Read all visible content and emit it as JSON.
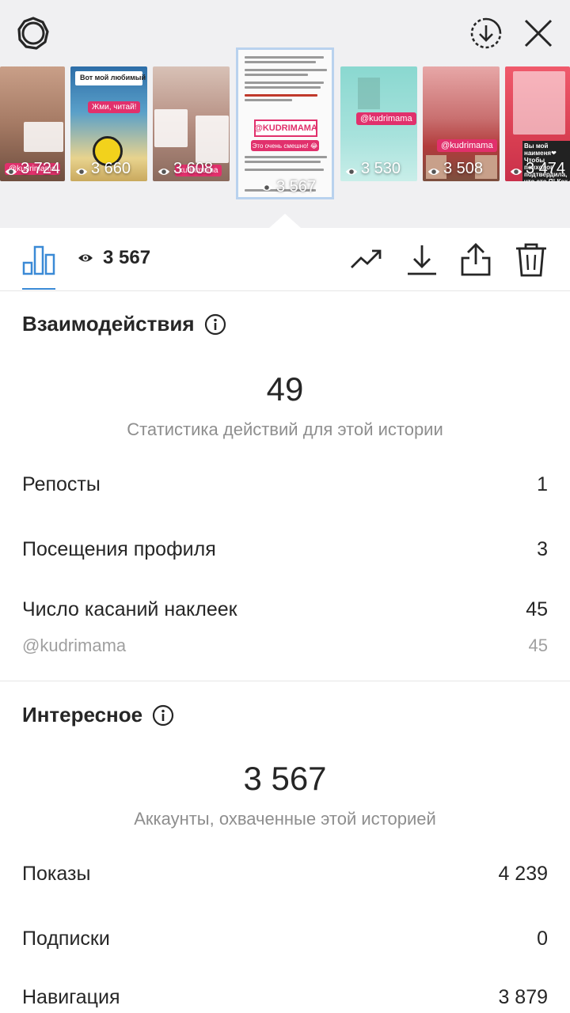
{
  "stories": [
    {
      "views": "3 724",
      "tag": "@kudrimama"
    },
    {
      "views": "3 660",
      "title": "Вот мой любимый 😅",
      "sticker": "Жми, читай!"
    },
    {
      "views": "3 608",
      "tag": "kudrimama"
    },
    {
      "views": "3 567",
      "current": true,
      "brand": "@KUDRIMAMA",
      "sticker": "Это очень смешно! 😂"
    },
    {
      "views": "3 530",
      "tag": "@kudrimama"
    },
    {
      "views": "3 508",
      "tag": "@kudrimama"
    },
    {
      "views": "3 474",
      "text": "Вы мой наименя❤ Чтобы психолог подтвердила, что это Я! Как за жизнь?"
    }
  ],
  "toolbar": {
    "view_count": "3 567"
  },
  "interactions": {
    "title": "Взаимодействия",
    "total": "49",
    "caption": "Статистика действий для этой истории",
    "rows": [
      {
        "label": "Репосты",
        "value": "1"
      },
      {
        "label": "Посещения профиля",
        "value": "3"
      },
      {
        "label": "Число касаний наклеек",
        "value": "45"
      }
    ],
    "sticker_row": {
      "label": "@kudrimama",
      "value": "45"
    }
  },
  "discovery": {
    "title": "Интересное",
    "total": "3 567",
    "caption": "Аккаунты, охваченные этой историей",
    "rows": [
      {
        "label": "Показы",
        "value": "4 239"
      },
      {
        "label": "Подписки",
        "value": "0"
      },
      {
        "label": "Навигация",
        "value": "3 879"
      }
    ]
  },
  "colors": {
    "accent": "#3b8ad6",
    "brand_pink": "#e1306c",
    "text": "#262626",
    "muted": "#8e8e8e"
  },
  "icons": [
    "settings-icon",
    "download-circle-icon",
    "close-icon",
    "bar-chart-icon",
    "eye-icon",
    "trend-icon",
    "download-icon",
    "share-icon",
    "trash-icon",
    "info-icon"
  ]
}
